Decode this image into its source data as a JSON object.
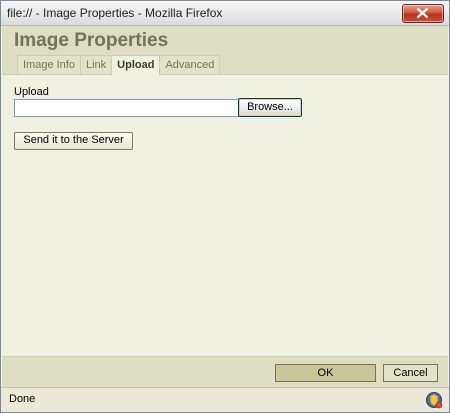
{
  "window": {
    "title": "file:// - Image Properties - Mozilla Firefox"
  },
  "dialog": {
    "title": "Image Properties",
    "tabs": [
      {
        "label": "Image Info",
        "active": false
      },
      {
        "label": "Link",
        "active": false
      },
      {
        "label": "Upload",
        "active": true
      },
      {
        "label": "Advanced",
        "active": false
      }
    ]
  },
  "upload": {
    "label": "Upload",
    "file_value": "",
    "browse_label": "Browse...",
    "send_label": "Send it to the Server"
  },
  "footer": {
    "ok_label": "OK",
    "cancel_label": "Cancel"
  },
  "statusbar": {
    "text": "Done",
    "icon": "security-shield-icon"
  },
  "colors": {
    "header_bg": "#dedec3",
    "content_bg": "#f1f1e3",
    "title_text": "#737357",
    "ok_bg": "#c7c79a"
  }
}
